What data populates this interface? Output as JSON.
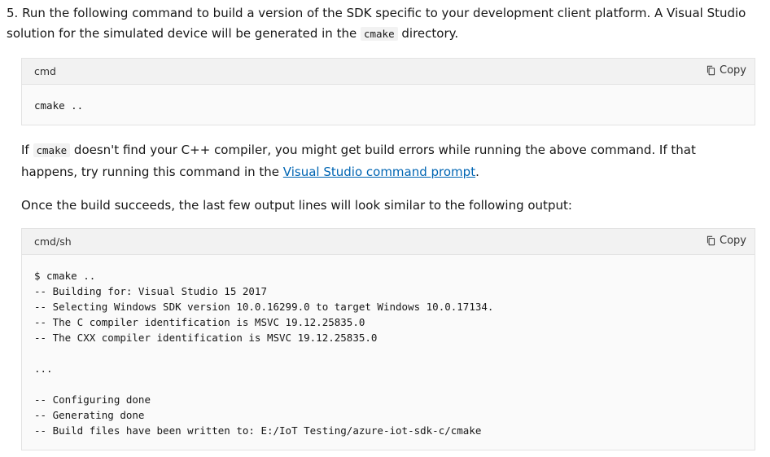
{
  "step": {
    "number": "5.",
    "text_part1": "Run the following command to build a version of the SDK specific to your development client platform. A Visual Studio solution for the simulated device will be generated in the",
    "code": "cmake",
    "text_part2": "directory."
  },
  "code_block_1": {
    "language": "cmd",
    "copy_label": "Copy",
    "code": "cmake .."
  },
  "paragraph_1": {
    "prefix": "If",
    "code": "cmake",
    "middle": "doesn't find your C++ compiler, you might get build errors while running the above command. If that happens, try running this command in the",
    "link_text": "Visual Studio command prompt",
    "suffix": "."
  },
  "paragraph_2": {
    "text": "Once the build succeeds, the last few output lines will look similar to the following output:"
  },
  "code_block_2": {
    "language": "cmd/sh",
    "copy_label": "Copy",
    "code": "$ cmake ..\n-- Building for: Visual Studio 15 2017\n-- Selecting Windows SDK version 10.0.16299.0 to target Windows 10.0.17134.\n-- The C compiler identification is MSVC 19.12.25835.0\n-- The CXX compiler identification is MSVC 19.12.25835.0\n\n...\n\n-- Configuring done\n-- Generating done\n-- Build files have been written to: E:/IoT Testing/azure-iot-sdk-c/cmake"
  },
  "icons": {
    "copy": "copy-icon"
  }
}
